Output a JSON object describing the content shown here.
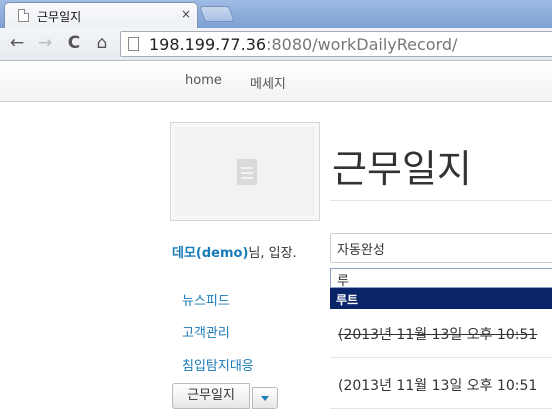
{
  "browser": {
    "tab_title": "근무일지",
    "tab_close": "×",
    "url_host": "198.199.77.36",
    "url_rest": ":8080/workDailyRecord/",
    "nav": {
      "back": "←",
      "forward": "→",
      "reload": "C",
      "home": "⌂"
    }
  },
  "navbar": {
    "items": [
      "home",
      "메세지"
    ]
  },
  "page": {
    "heading": "근무일지"
  },
  "sidebar": {
    "user_name": "데모(demo)",
    "welcome_suffix": "님, 입장.",
    "links": [
      "뉴스피드",
      "고객관리",
      "침입탐지대응"
    ],
    "current_button": "근무일지"
  },
  "form": {
    "autocomplete_value": "자동완성",
    "suggest_query": "루",
    "suggest_item": "루트"
  },
  "records": [
    {
      "text": "(2013년 11월 13일 오후 10:51",
      "struck": true
    },
    {
      "text": "(2013년 11월 13일 오후 10:51",
      "struck": false
    }
  ],
  "colors": {
    "link": "#1a7bb9",
    "highlight": "#0a246a"
  }
}
